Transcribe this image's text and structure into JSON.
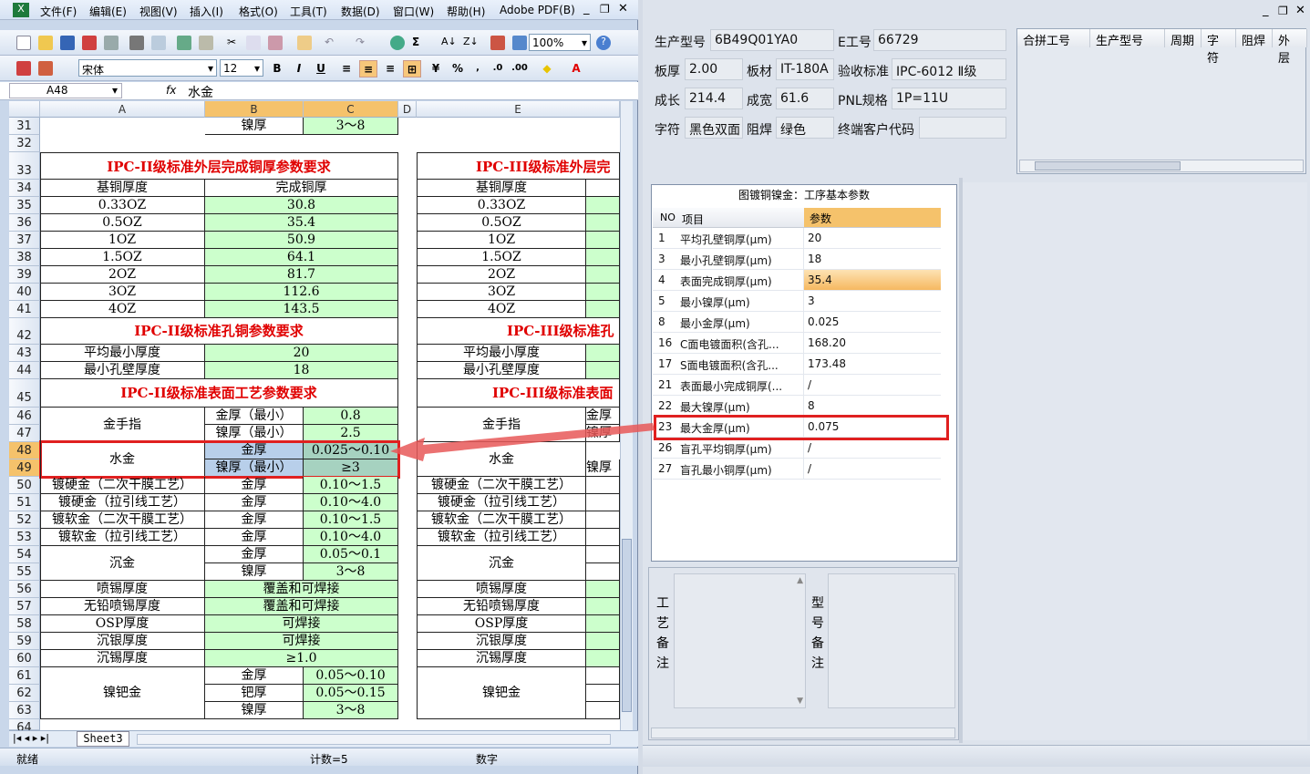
{
  "excel": {
    "menu": [
      "文件(F)",
      "编辑(E)",
      "视图(V)",
      "插入(I)",
      "格式(O)",
      "工具(T)",
      "数据(D)",
      "窗口(W)",
      "帮助(H)",
      "Adobe PDF(B)"
    ],
    "zoom": "100%",
    "font_name": "宋体",
    "font_size": "12",
    "name_box": "A48",
    "fx": "fx",
    "formula": "水金",
    "columns": [
      "A",
      "B",
      "C",
      "D",
      "E"
    ],
    "sheet_tab": "Sheet3",
    "status_ready": "就绪",
    "status_count": "计数=5",
    "status_num": "数字",
    "rows": {
      "r31": {
        "num": "31",
        "b": "镍厚",
        "c": "3～8"
      },
      "r32": {
        "num": "32"
      },
      "r33": {
        "num": "33",
        "title": "IPC-II级标准外层完成铜厚参数要求",
        "title_e": "IPC-III级标准外层完"
      },
      "r34": {
        "num": "34",
        "a": "基铜厚度",
        "b": "完成铜厚",
        "e": "基铜厚度"
      },
      "r35": {
        "num": "35",
        "a": "0.33OZ",
        "b": "30.8",
        "e": "0.33OZ"
      },
      "r36": {
        "num": "36",
        "a": "0.5OZ",
        "b": "35.4",
        "e": "0.5OZ"
      },
      "r37": {
        "num": "37",
        "a": "1OZ",
        "b": "50.9",
        "e": "1OZ"
      },
      "r38": {
        "num": "38",
        "a": "1.5OZ",
        "b": "64.1",
        "e": "1.5OZ"
      },
      "r39": {
        "num": "39",
        "a": "2OZ",
        "b": "81.7",
        "e": "2OZ"
      },
      "r40": {
        "num": "40",
        "a": "3OZ",
        "b": "112.6",
        "e": "3OZ"
      },
      "r41": {
        "num": "41",
        "a": "4OZ",
        "b": "143.5",
        "e": "4OZ"
      },
      "r42": {
        "num": "42",
        "title": "IPC-II级标准孔铜参数要求",
        "title_e": "IPC-III级标准孔"
      },
      "r43": {
        "num": "43",
        "a": "平均最小厚度",
        "b": "20",
        "e": "平均最小厚度"
      },
      "r44": {
        "num": "44",
        "a": "最小孔壁厚度",
        "b": "18",
        "e": "最小孔壁厚度"
      },
      "r45": {
        "num": "45",
        "title": "IPC-II级标准表面工艺参数要求",
        "title_e": "IPC-III级标准表面"
      },
      "r46": {
        "num": "46",
        "b": "金厚（最小）",
        "c": "0.8",
        "e_b": "金厚"
      },
      "r47": {
        "num": "47",
        "b": "镍厚（最小）",
        "c": "2.5",
        "e_b": "镍厚"
      },
      "r46_a": "金手指",
      "r48": {
        "num": "48",
        "b": "金厚",
        "c": "0.025～0.10"
      },
      "r49": {
        "num": "49",
        "b": "镍厚（最小）",
        "c": "≥3",
        "e_b": "镍厚"
      },
      "r48_a": "水金",
      "r50": {
        "num": "50",
        "a": "镀硬金（二次干膜工艺）",
        "b": "金厚",
        "c": "0.10～1.5",
        "e": "镀硬金（二次干膜工艺）"
      },
      "r51": {
        "num": "51",
        "a": "镀硬金（拉引线工艺）",
        "b": "金厚",
        "c": "0.10～4.0",
        "e": "镀硬金（拉引线工艺）"
      },
      "r52": {
        "num": "52",
        "a": "镀软金（二次干膜工艺）",
        "b": "金厚",
        "c": "0.10～1.5",
        "e": "镀软金（二次干膜工艺）"
      },
      "r53": {
        "num": "53",
        "a": "镀软金（拉引线工艺）",
        "b": "金厚",
        "c": "0.10～4.0",
        "e": "镀软金（拉引线工艺）"
      },
      "r54": {
        "num": "54",
        "b": "金厚",
        "c": "0.05～0.1"
      },
      "r55": {
        "num": "55",
        "b": "镍厚",
        "c": "3～8"
      },
      "r54_a": "沉金",
      "r56": {
        "num": "56",
        "a": "喷锡厚度",
        "bc": "覆盖和可焊接",
        "e": "喷锡厚度"
      },
      "r57": {
        "num": "57",
        "a": "无铅喷锡厚度",
        "bc": "覆盖和可焊接",
        "e": "无铅喷锡厚度"
      },
      "r58": {
        "num": "58",
        "a": "OSP厚度",
        "bc": "可焊接",
        "e": "OSP厚度"
      },
      "r59": {
        "num": "59",
        "a": "沉银厚度",
        "bc": "可焊接",
        "e": "沉银厚度"
      },
      "r60": {
        "num": "60",
        "a": "沉锡厚度",
        "bc": "≥1.0",
        "e": "沉锡厚度"
      },
      "r61": {
        "num": "61",
        "b": "金厚",
        "c": "0.05～0.10"
      },
      "r62": {
        "num": "62",
        "b": "钯厚",
        "c": "0.05～0.15"
      },
      "r63": {
        "num": "63",
        "b": "镍厚",
        "c": "3～8"
      },
      "r61_a": "镍钯金",
      "r64": {
        "num": "64"
      }
    }
  },
  "app": {
    "fields": {
      "model_label": "生产型号",
      "model": "6B49Q01YA0",
      "eno_label": "E工号",
      "eno": "66729",
      "thick_label": "板厚",
      "thick": "2.00",
      "material_label": "板材",
      "material": "IT-180A",
      "std_label": "验收标准",
      "std": "IPC-6012 Ⅱ级",
      "len_label": "成长",
      "len": "214.4",
      "wid_label": "成宽",
      "wid": "61.6",
      "pnl_label": "PNL规格",
      "pnl": "1P=11U",
      "char_label": "字符",
      "char": "黑色双面",
      "mask_label": "阻焊",
      "mask": "绿色",
      "cust_label": "终端客户代码",
      "cust": ""
    },
    "merge_headers": [
      "合拼工号",
      "生产型号",
      "周期",
      "字符",
      "阻焊",
      "外层"
    ],
    "params_title": "图镀铜镍金：工序基本参数",
    "params_headers": [
      "NO",
      "项目",
      "参数"
    ],
    "params": [
      {
        "no": "1",
        "item": "平均孔壁铜厚(μm)",
        "val": "20"
      },
      {
        "no": "3",
        "item": "最小孔壁铜厚(μm)",
        "val": "18"
      },
      {
        "no": "4",
        "item": "表面完成铜厚(μm)",
        "val": "35.4"
      },
      {
        "no": "5",
        "item": "最小镍厚(μm)",
        "val": "3"
      },
      {
        "no": "8",
        "item": "最小金厚(μm)",
        "val": "0.025"
      },
      {
        "no": "16",
        "item": "C面电镀面积(含孔...",
        "val": "168.20"
      },
      {
        "no": "17",
        "item": "S面电镀面积(含孔...",
        "val": "173.48"
      },
      {
        "no": "21",
        "item": "表面最小完成铜厚(...",
        "val": "/"
      },
      {
        "no": "22",
        "item": "最大镍厚(μm)",
        "val": "8"
      },
      {
        "no": "23",
        "item": "最大金厚(μm)",
        "val": "0.075"
      },
      {
        "no": "26",
        "item": "盲孔平均铜厚(μm)",
        "val": "/"
      },
      {
        "no": "27",
        "item": "盲孔最小铜厚(μm)",
        "val": "/"
      }
    ],
    "note1_label": "工艺备注",
    "note2_label": "型号备注"
  },
  "colors": {
    "highlight_red": "#e02020",
    "green_cell": "#ccffcc",
    "orange_header": "#f5c26b"
  }
}
